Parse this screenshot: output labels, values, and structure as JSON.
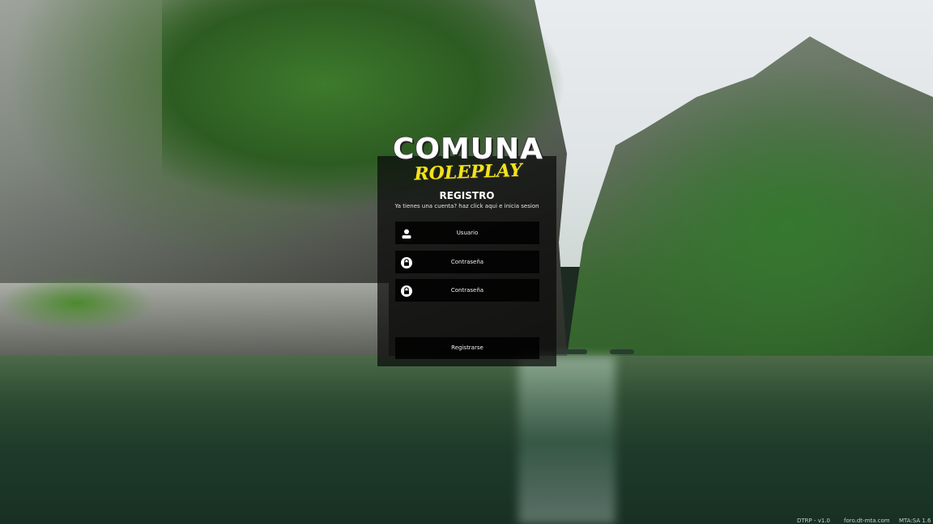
{
  "logo": {
    "line1": "COMUNA",
    "line2": "ROLEPLAY"
  },
  "form": {
    "title": "REGISTRO",
    "subtitle": "Ya tienes una cuenta? haz click aqui e inicia sesion",
    "fields": [
      {
        "label": "Usuario",
        "icon": "user-icon"
      },
      {
        "label": "Contraseña",
        "icon": "lock-icon"
      },
      {
        "label": "Contraseña",
        "icon": "lock-icon"
      }
    ],
    "submit_label": "Registrarse"
  },
  "footer": {
    "version": "DTRP - v1.0",
    "forum": "foro.dt-mta.com",
    "mta": "MTA:SA 1.6"
  },
  "colors": {
    "logo_yellow": "#f4e21a",
    "panel_bg": "rgba(10,10,10,0.72)"
  }
}
